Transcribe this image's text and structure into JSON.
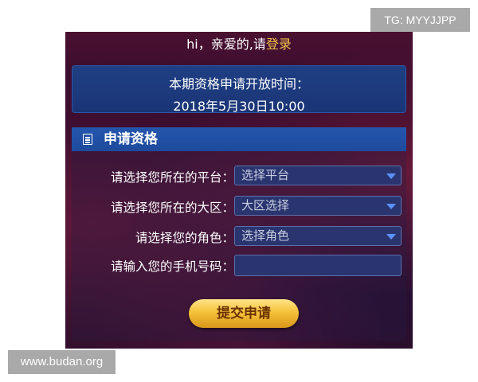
{
  "watermark_top": "TG: MYYJJPP",
  "watermark_bottom": "www.budan.org",
  "greeting": {
    "prefix": "hi，亲爱的,请",
    "login_link": "登录"
  },
  "open_time": {
    "line1": "本期资格申请开放时间：",
    "line2": "2018年5月30日10:00"
  },
  "section": {
    "title": "申请资格",
    "fields": [
      {
        "label": "请选择您所在的平台：",
        "value": "选择平台"
      },
      {
        "label": "请选择您所在的大区：",
        "value": "大区选择"
      },
      {
        "label": "请选择您的角色：",
        "value": "选择角色"
      },
      {
        "label": "请输入您的手机号码：",
        "value": ""
      }
    ],
    "submit_label": "提交申请"
  },
  "colors": {
    "accent": "#1d4a9c",
    "login": "#f2c24a",
    "button": "#f5c23a"
  }
}
